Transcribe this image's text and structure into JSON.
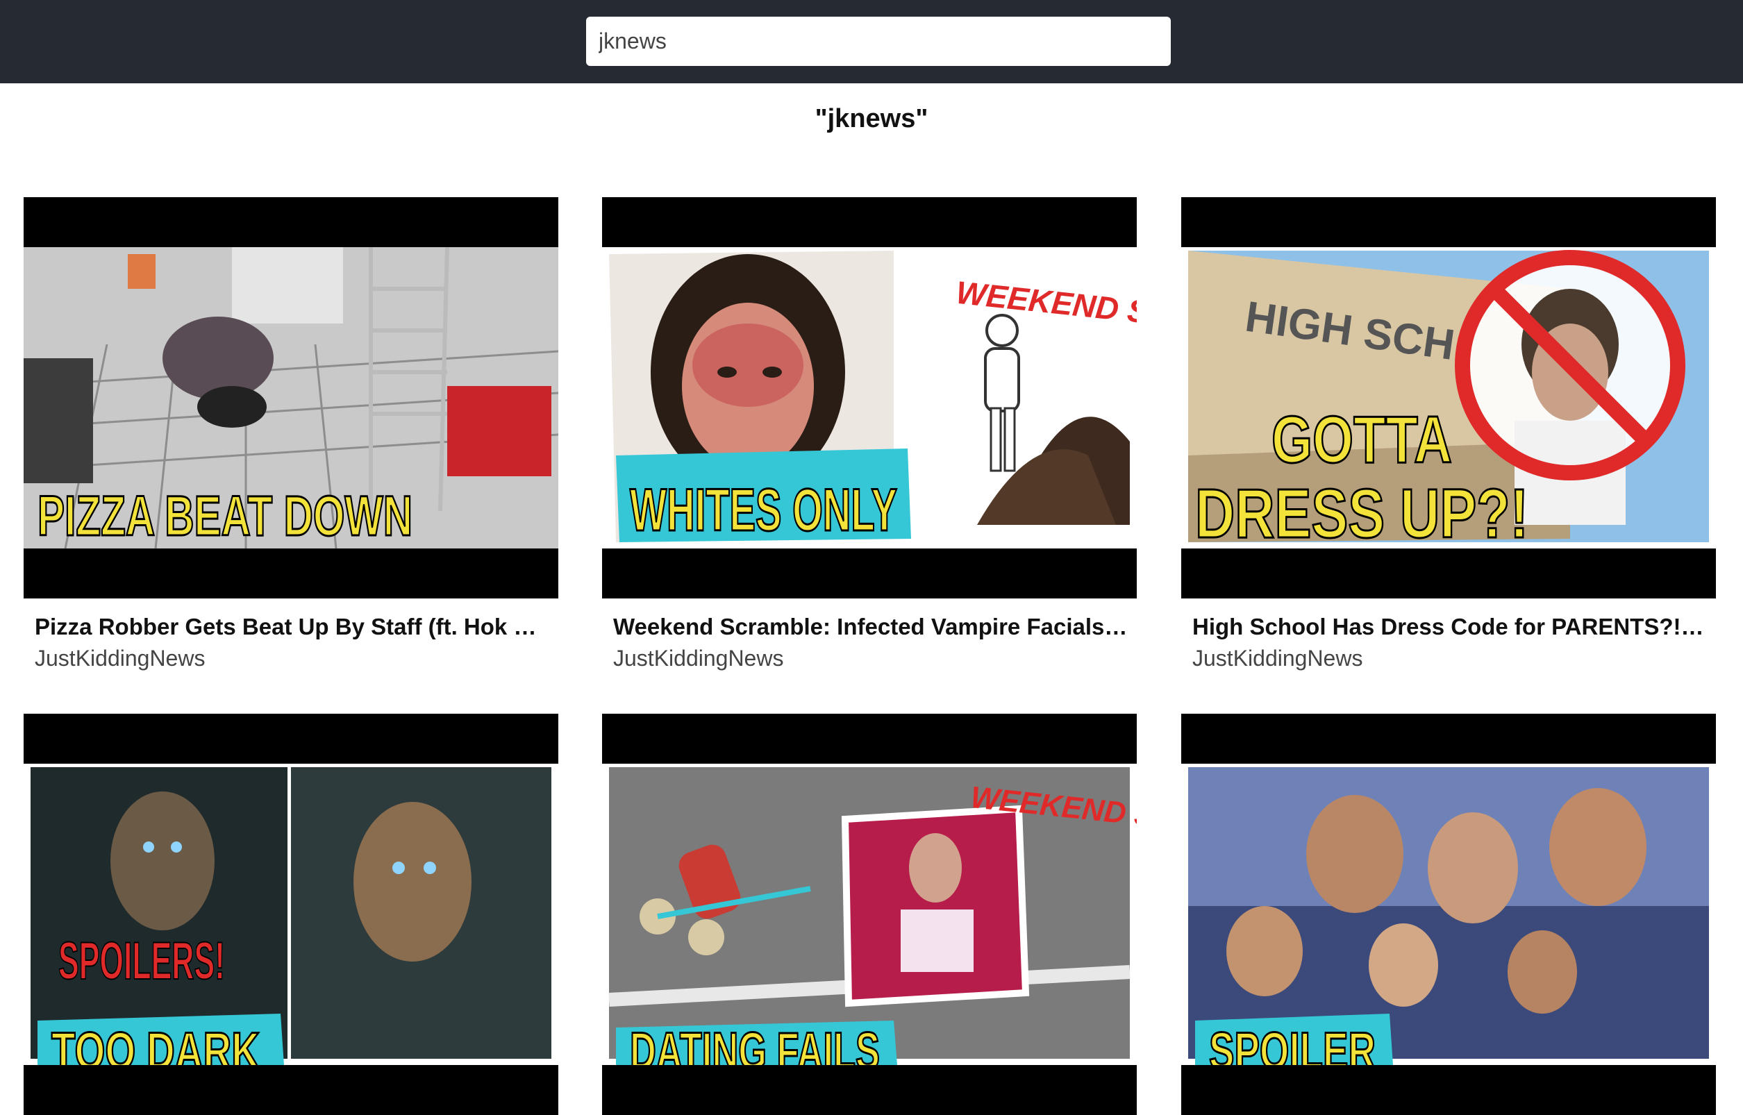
{
  "search": {
    "value": "jknews"
  },
  "results_heading": "\"jknews\"",
  "videos": [
    {
      "title": "Pizza Robber Gets Beat Up By Staff (ft. Hok & ...",
      "channel": "JustKiddingNews",
      "caption": "PIZZA BEAT DOWN"
    },
    {
      "title": "Weekend Scramble: Infected Vampire Facials |...",
      "channel": "JustKiddingNews",
      "caption": "WHITES ONLY",
      "tag": "WEEKEND SCRAMBLE!"
    },
    {
      "title": "High School Has Dress Code for PARENTS?! (ft...",
      "channel": "JustKiddingNews",
      "caption_line1": "GOTTA",
      "caption_line2": "DRESS UP?!",
      "sign": "HIGH SCH"
    },
    {
      "caption": "SPOILERS!",
      "caption2": "TOO DARK"
    },
    {
      "tag": "WEEKEND SCRAMBLE!",
      "caption": "DATING FAILS"
    },
    {
      "caption": "SPOILER"
    }
  ],
  "colors": {
    "topbar": "#262a33",
    "caption_yellow": "#f2e23a",
    "caption_bg": "#35c7d6",
    "tag_red": "#e02a2a"
  }
}
